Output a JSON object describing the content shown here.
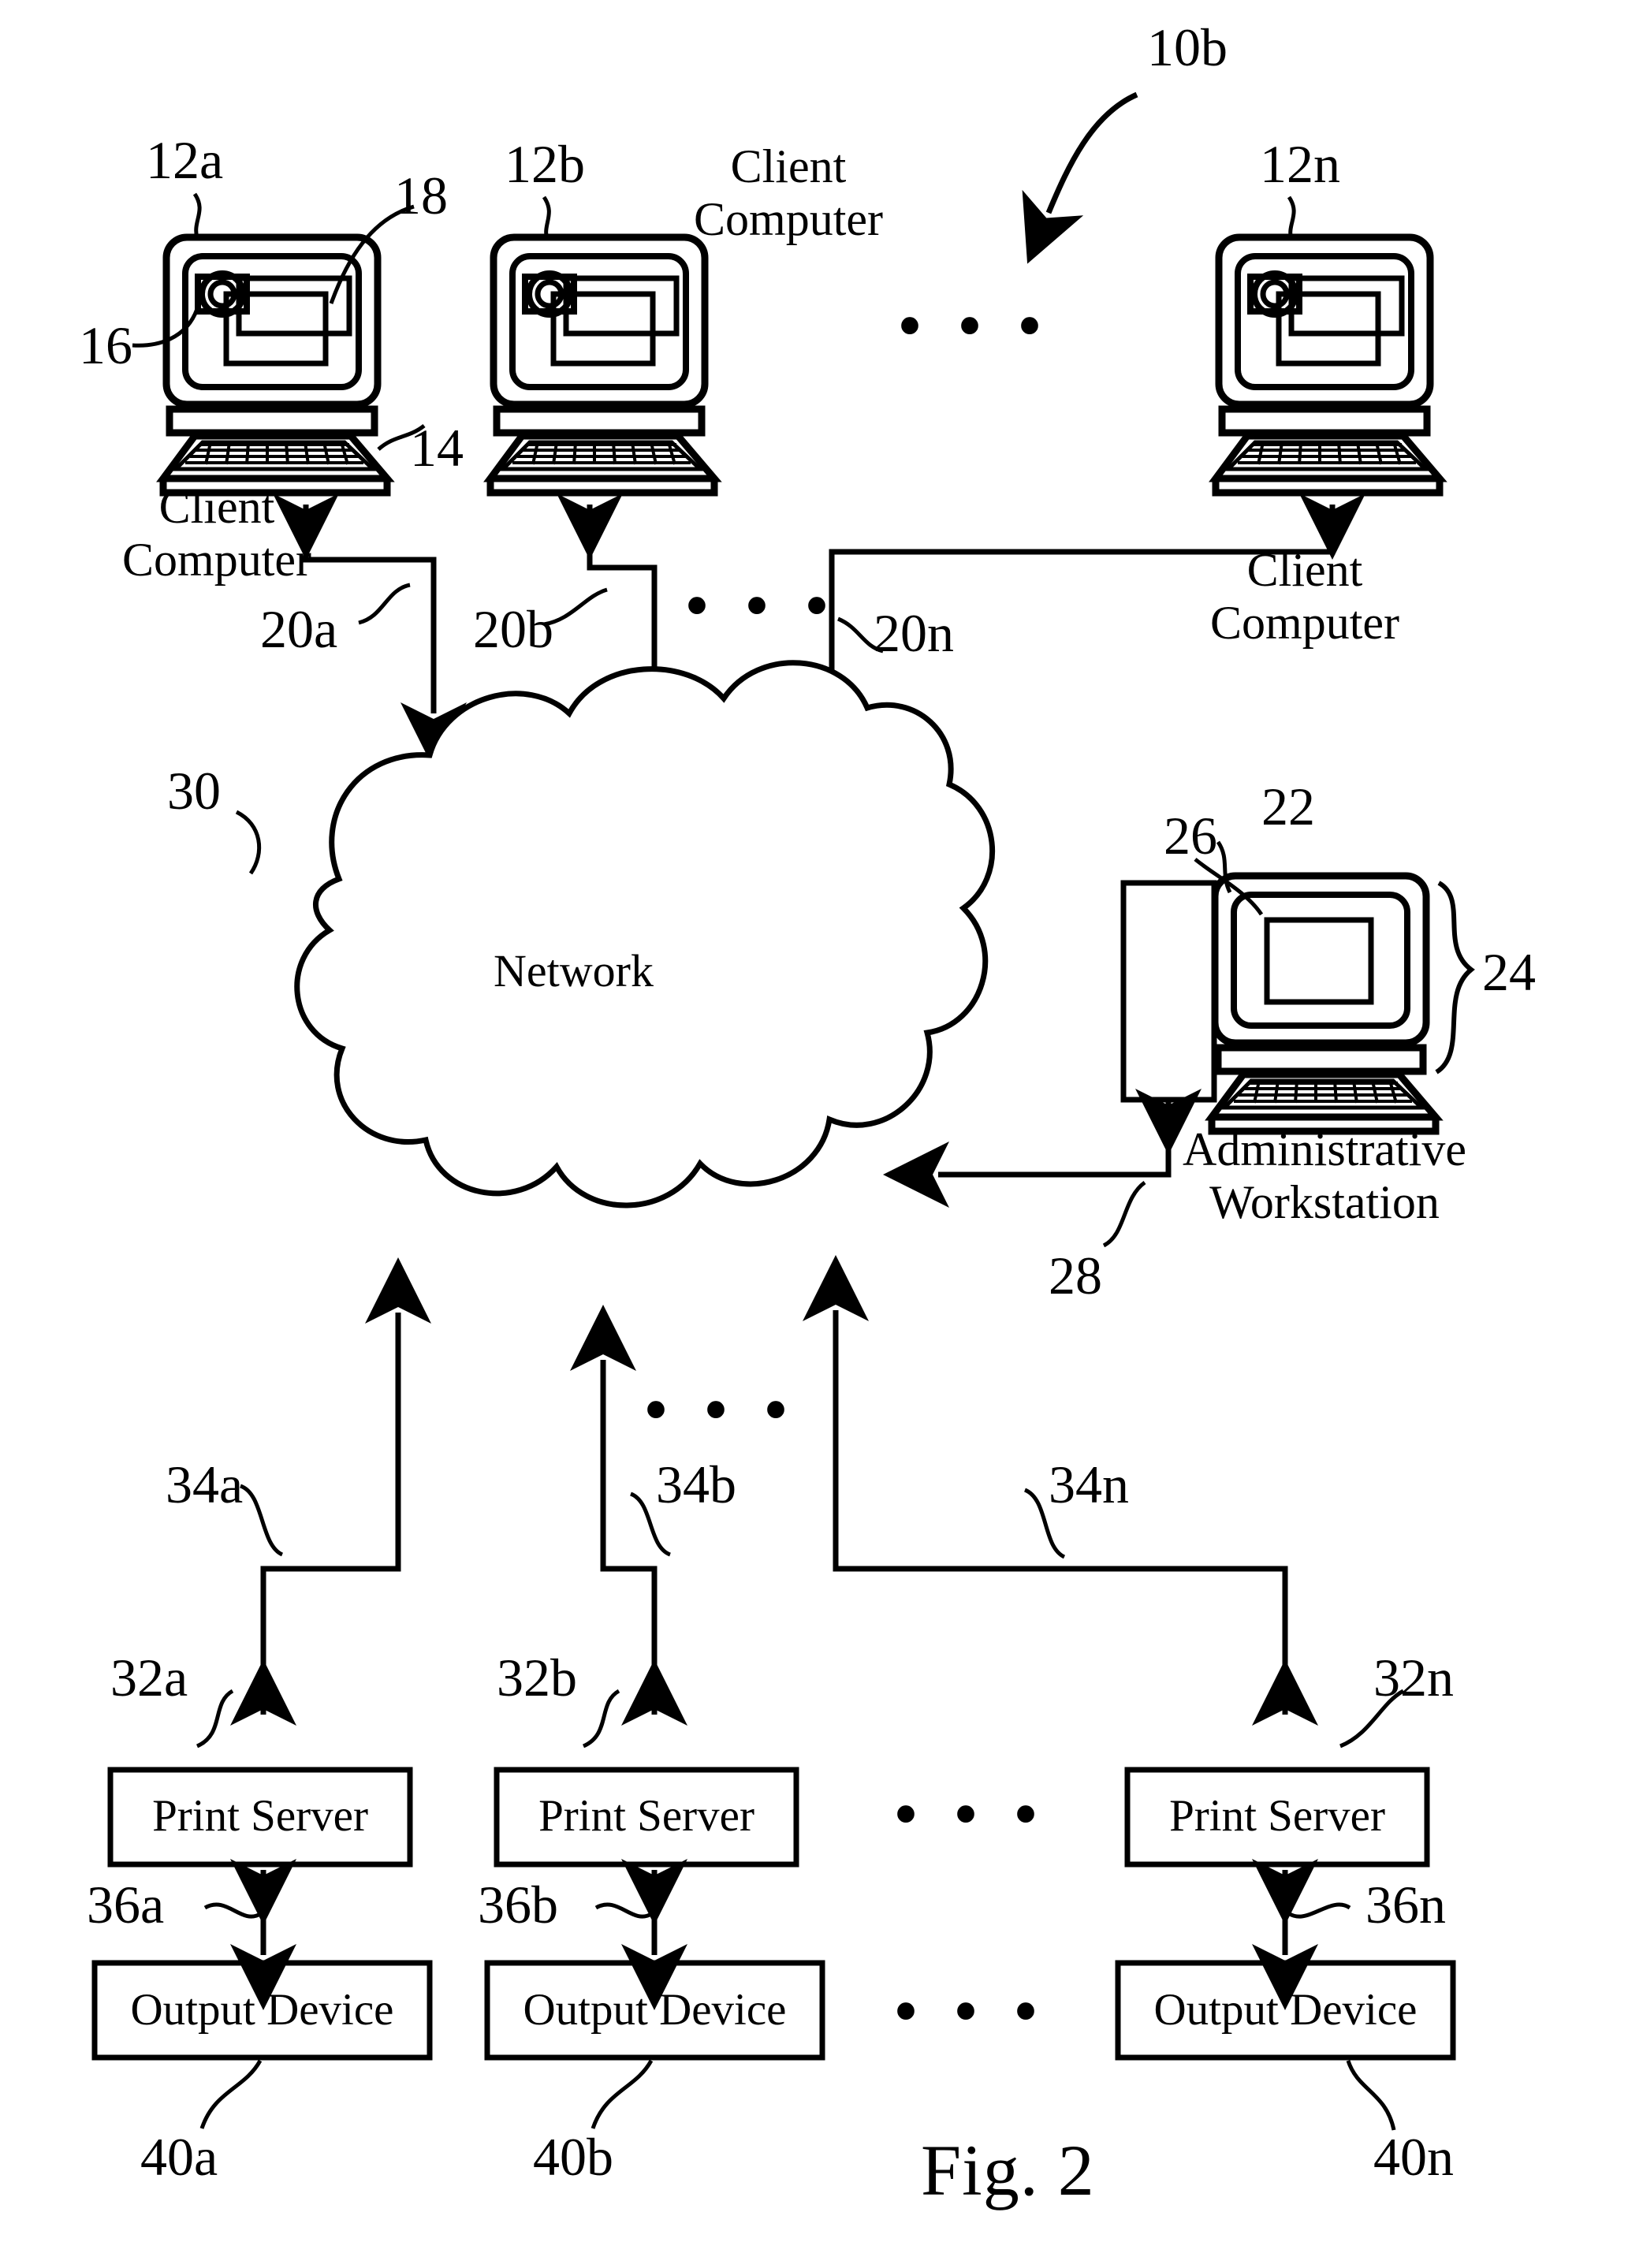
{
  "figure": {
    "label": "Fig. 2",
    "system_ref": "10b",
    "network_label": "Network",
    "ellipsis": "• • •"
  },
  "client_computers": [
    {
      "ref": "12a",
      "caption_line1": "Client",
      "caption_line2": "Computer",
      "screen_ref": "14",
      "mouse_ref": "16",
      "window_ref": "18",
      "link_ref": "20a"
    },
    {
      "ref": "12b",
      "caption_line1": "Client",
      "caption_line2": "Computer",
      "link_ref": "20b"
    },
    {
      "ref": "12n",
      "caption_line1": "Client",
      "caption_line2": "Computer",
      "link_ref": "20n"
    }
  ],
  "network": {
    "ref": "30",
    "label": "Network"
  },
  "admin_workstation": {
    "ref": "24",
    "screen_ref": "22",
    "window_ref": "26",
    "link_ref": "28",
    "caption_line1": "Administrative",
    "caption_line2": "Workstation"
  },
  "print_servers": [
    {
      "label": "Print Server",
      "ref": "32a",
      "uplink_ref": "34a",
      "downlink_ref": "36a"
    },
    {
      "label": "Print Server",
      "ref": "32b",
      "uplink_ref": "34b",
      "downlink_ref": "36b"
    },
    {
      "label": "Print Server",
      "ref": "32n",
      "uplink_ref": "34n",
      "downlink_ref": "36n"
    }
  ],
  "output_devices": [
    {
      "label": "Output Device",
      "ref": "40a"
    },
    {
      "label": "Output Device",
      "ref": "40b"
    },
    {
      "label": "Output Device",
      "ref": "40n"
    }
  ],
  "colors": {
    "ink": "#000000",
    "paper": "#ffffff"
  }
}
